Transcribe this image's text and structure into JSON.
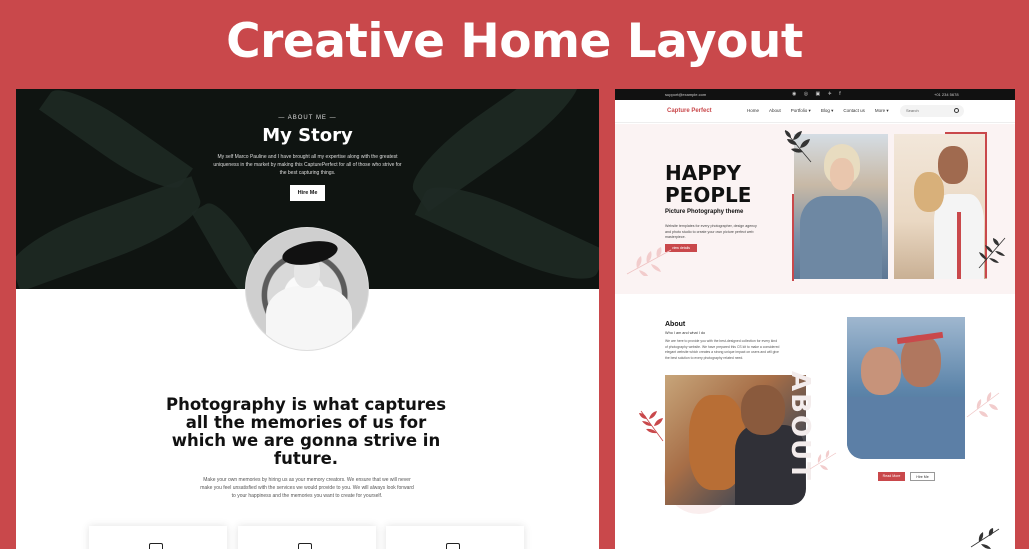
{
  "banner": {
    "title": "Creative Home Layout"
  },
  "left": {
    "kicker": "— ABOUT ME —",
    "title": "My Story",
    "text": "My self Marco Pauline and I have brought all my expertise along with the greatest uniqueness in the market by making this CapturePerfect for all of those who strive for the best capturing things.",
    "hire_label": "Hire Me",
    "quote": "Photography is what captures all the memories of us for which we are gonna strive in future.",
    "quote_sub": "Make your own memories by hiring us as your memory creators. We ensure that we will never make you feel unsatisfied with the services we would provide to you. We will always look forward to your happiness and the memories you want to create for yourself."
  },
  "right": {
    "topbar": {
      "email": "support@example.com",
      "socials": "◉ ◎ ▣ ✈ f",
      "phone": "+01 234 5678"
    },
    "brand": "Capture Perfect",
    "menu": [
      "Home",
      "About",
      "Portfolio ▾",
      "Blog ▾",
      "Contact us",
      "More ▾"
    ],
    "search_placeholder": "Search",
    "hero": {
      "title_line1": "HAPPY",
      "title_line2": "PEOPLE",
      "subtitle": "Picture Photography theme",
      "desc": "Website templates for every photographer, design agency and photo studio to create your own picture perfect web masterpiece.",
      "button": "view details"
    },
    "about": {
      "title": "About",
      "sub": "Who I am and what I do",
      "desc": "We are here to provide you with the best-designed collection for every kind of photography website. We have prepared this CS kit to make a considered elegant website which creates a strong unique impact on users and will give the best solution to every photography related need.",
      "watermark": "ABOUT",
      "read_more": "Read More",
      "hire_me": "Hire Me"
    }
  },
  "colors": {
    "background": "#c9484b",
    "accent": "#c9484b",
    "hero_dark": "#0f1411"
  }
}
